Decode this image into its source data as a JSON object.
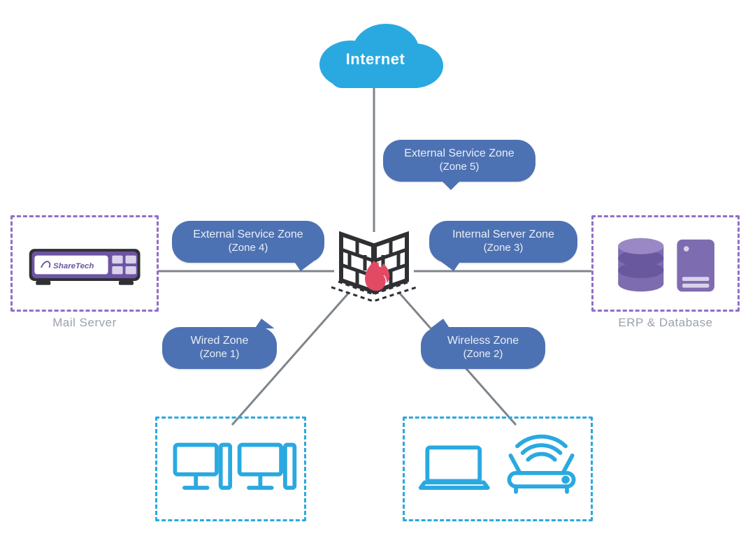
{
  "internet": {
    "label": "Internet"
  },
  "zones": {
    "z5": {
      "line1": "External Service Zone",
      "line2": "(Zone 5)"
    },
    "z4": {
      "line1": "External Service Zone",
      "line2": "(Zone 4)"
    },
    "z3": {
      "line1": "Internal Server Zone",
      "line2": "(Zone 3)"
    },
    "z1": {
      "line1": "Wired Zone",
      "line2": "(Zone 1)"
    },
    "z2": {
      "line1": "Wireless Zone",
      "line2": "(Zone 2)"
    }
  },
  "captions": {
    "mail": "Mail Server",
    "erp": "ERP & Database",
    "brand": "ShareTech"
  },
  "colors": {
    "accent_blue": "#4d72b3",
    "cloud_blue": "#2aa9e0",
    "purple": "#8f6fc6",
    "cyan": "#2aa9e0",
    "fire": "#e24a63",
    "dark": "#2e3033",
    "grey_line": "#7e858b"
  },
  "nodes": {
    "center": "firewall-icon",
    "left_box": "mail-server-appliance",
    "right_box": "erp-database",
    "bottom_left_box": "wired-clients-desktops",
    "bottom_right_box": "wireless-clients-laptop-router"
  }
}
